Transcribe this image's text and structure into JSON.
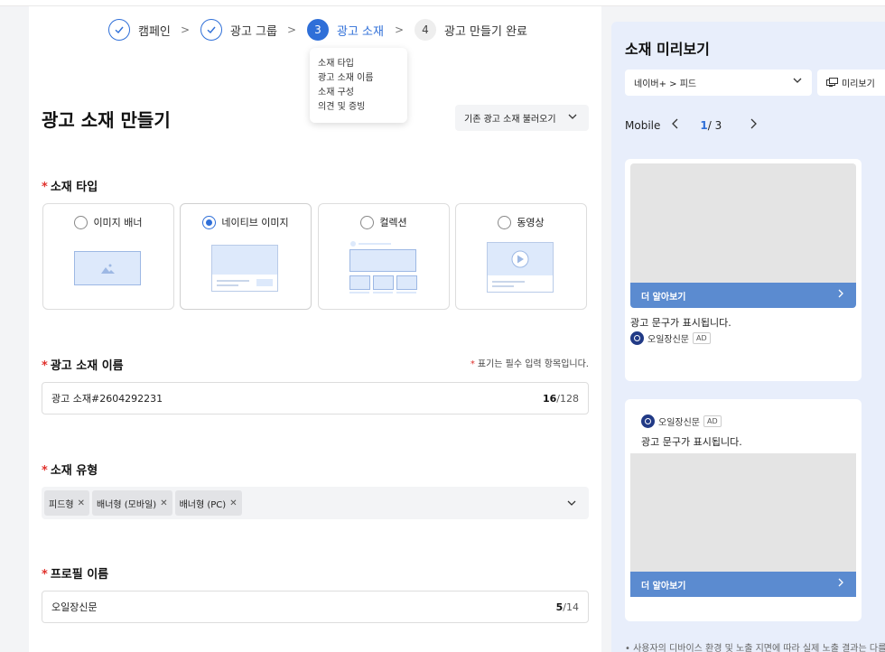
{
  "steps": [
    {
      "label": "캠페인",
      "state": "done"
    },
    {
      "label": "광고 그룹",
      "state": "done"
    },
    {
      "label": "광고 소재",
      "number": "3",
      "state": "active"
    },
    {
      "label": "광고 만들기 완료",
      "number": "4",
      "state": "todo"
    }
  ],
  "tooltip": {
    "items": [
      "소재 타입",
      "광고 소재 이름",
      "소재 구성",
      "의견 및 증빙"
    ]
  },
  "page_title": "광고 소재 만들기",
  "load_button": "기존 광고 소재 불러오기",
  "creative_type": {
    "label": "소재 타입",
    "required_mark": "*",
    "options": [
      {
        "label": "이미지 배너",
        "selected": false
      },
      {
        "label": "네이티브 이미지",
        "selected": true
      },
      {
        "label": "컬렉션",
        "selected": false
      },
      {
        "label": "동영상",
        "selected": false
      }
    ]
  },
  "creative_name": {
    "label": "광고 소재 이름",
    "required_mark": "*",
    "required_note": "표기는 필수 입력 항목입니다.",
    "value": "광고 소재#2604292231",
    "count": "16",
    "max": "/128"
  },
  "creative_format": {
    "label": "소재 유형",
    "required_mark": "*",
    "tags": [
      "피드형",
      "배너형 (모바일)",
      "배너형 (PC)"
    ]
  },
  "profile_name": {
    "label": "프로필 이름",
    "required_mark": "*",
    "value": "오일장신문",
    "count": "5",
    "max": "/14"
  },
  "preview": {
    "title": "소재 미리보기",
    "placement": "네이버+ > 피드",
    "preview_button": "미리보기",
    "device": "Mobile",
    "page_current": "1",
    "page_total": " / 3",
    "cta_label": "더 알아보기",
    "ad_text": "광고 문구가 표시됩니다.",
    "brand": "오일장신문",
    "ad_badge": "AD",
    "footnote": "• 사용자의 디바이스 환경 및 노출 지면에 따라 실제 노출 결과는 다를"
  },
  "colors": {
    "accent": "#2f6fd8",
    "required": "#e0312c",
    "cta": "#5b8bd0",
    "preview_bg": "#e8eefb"
  }
}
